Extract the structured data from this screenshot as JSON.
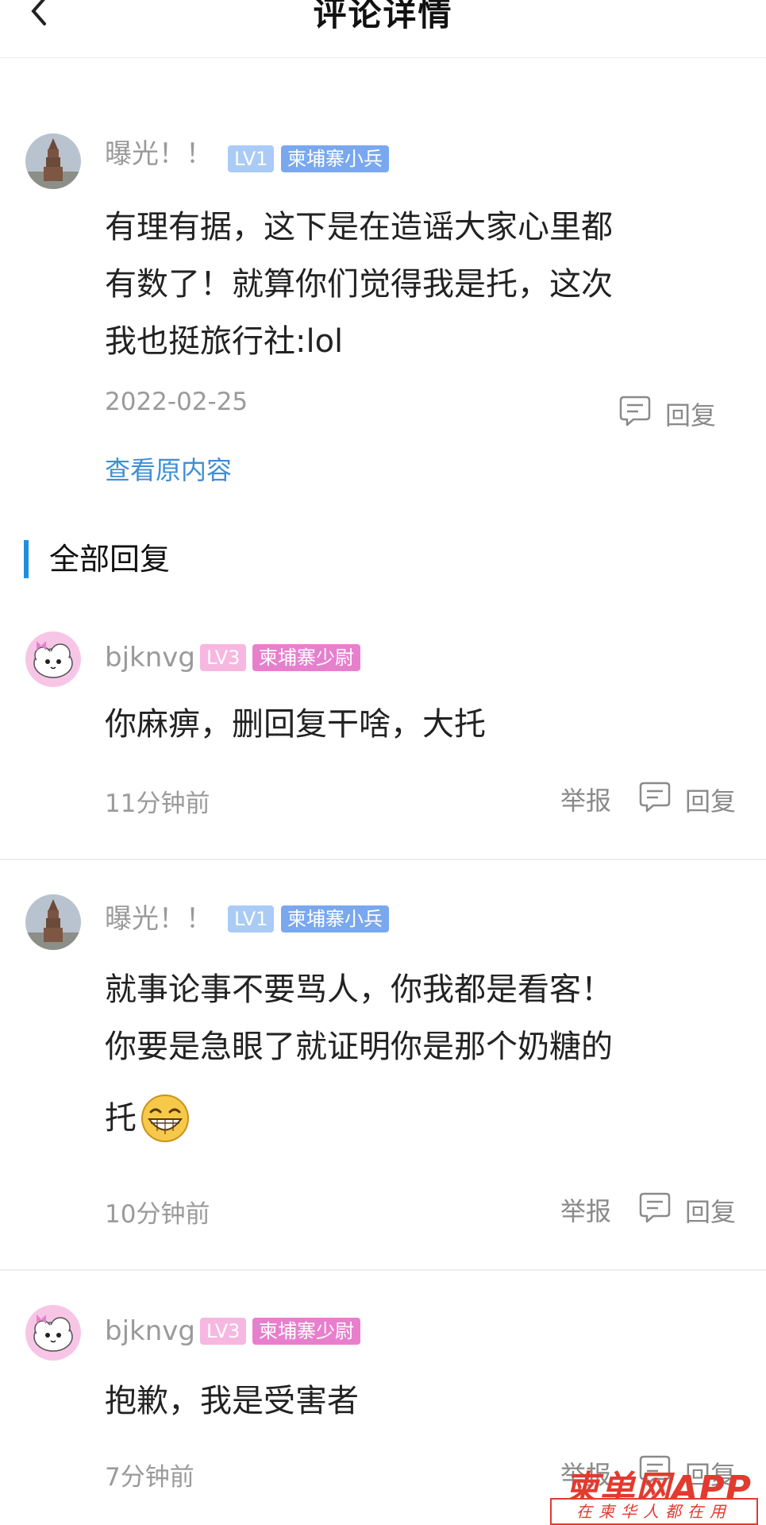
{
  "header": {
    "title": "评论详情"
  },
  "main_comment": {
    "username": "曝光！！",
    "level": "LV1",
    "rank": "柬埔寨小兵",
    "lines": [
      "有理有据，这下是在造谣大家心里都",
      "有数了！就算你们觉得我是托，这次",
      "我也挺旅行社:lol"
    ],
    "date": "2022-02-25",
    "reply_label": "回复",
    "view_original": "查看原内容"
  },
  "section": {
    "title": "全部回复"
  },
  "replies": [
    {
      "username": "bjknvg",
      "level": "LV3",
      "rank": "柬埔寨少尉",
      "text": "你麻痹，删回复干啥，大托",
      "time": "11分钟前",
      "report": "举报",
      "reply": "回复"
    },
    {
      "username": "曝光！！",
      "level": "LV1",
      "rank": "柬埔寨小兵",
      "line1": "就事论事不要骂人，你我都是看客！",
      "line2": "你要是急眼了就证明你是那个奶糖的",
      "line3": "托",
      "emoji": "grinning-emoji",
      "time": "10分钟前",
      "report": "举报",
      "reply": "回复"
    },
    {
      "username": "bjknvg",
      "level": "LV3",
      "rank": "柬埔寨少尉",
      "text": "抱歉，我是受害者",
      "time": "7分钟前",
      "report": "举报",
      "reply": "回复"
    }
  ],
  "watermark": {
    "logo": "柬单网APP",
    "slogan": "在柬华人都在用"
  },
  "colors": {
    "accent": "#1f8fe0",
    "link": "#3d8fd6",
    "badge_blue": "#7aa8ef",
    "badge_pink": "#e87fcd",
    "watermark": "#e33a2f"
  }
}
